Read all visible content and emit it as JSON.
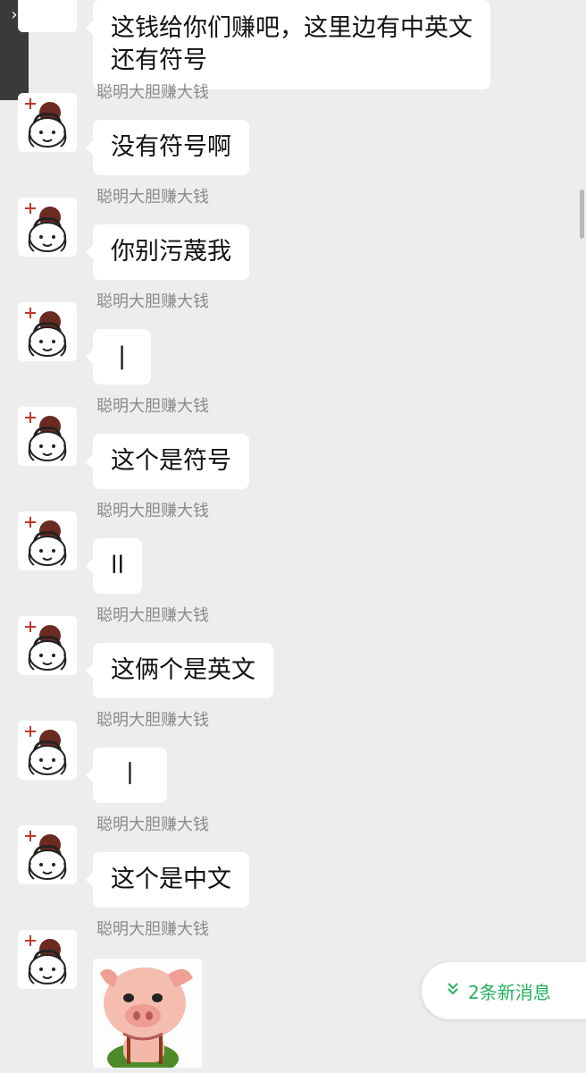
{
  "top_message": {
    "text_line1": "这钱给你们赚吧，这里边有中英文",
    "text_line2": "还有符号"
  },
  "sender_name": "聪明大胆赚大钱",
  "messages": [
    {
      "sender": "聪明大胆赚大钱",
      "text": "没有符号啊"
    },
    {
      "sender": "聪明大胆赚大钱",
      "text": "你别污蔑我"
    },
    {
      "sender": "聪明大胆赚大钱",
      "text": "|"
    },
    {
      "sender": "聪明大胆赚大钱",
      "text": "这个是符号"
    },
    {
      "sender": "聪明大胆赚大钱",
      "text": "ll"
    },
    {
      "sender": "聪明大胆赚大钱",
      "text": "这俩个是英文"
    },
    {
      "sender": "聪明大胆赚大钱",
      "text": "丨"
    },
    {
      "sender": "聪明大胆赚大钱",
      "text": "这个是中文"
    },
    {
      "sender": "聪明大胆赚大钱",
      "sticker": "pig-sticker"
    }
  ],
  "new_messages": {
    "label": "2条新消息",
    "icon": "double-chevron-down-icon"
  },
  "colors": {
    "background": "#ededed",
    "bubble": "#ffffff",
    "accent": "#23b15a"
  }
}
